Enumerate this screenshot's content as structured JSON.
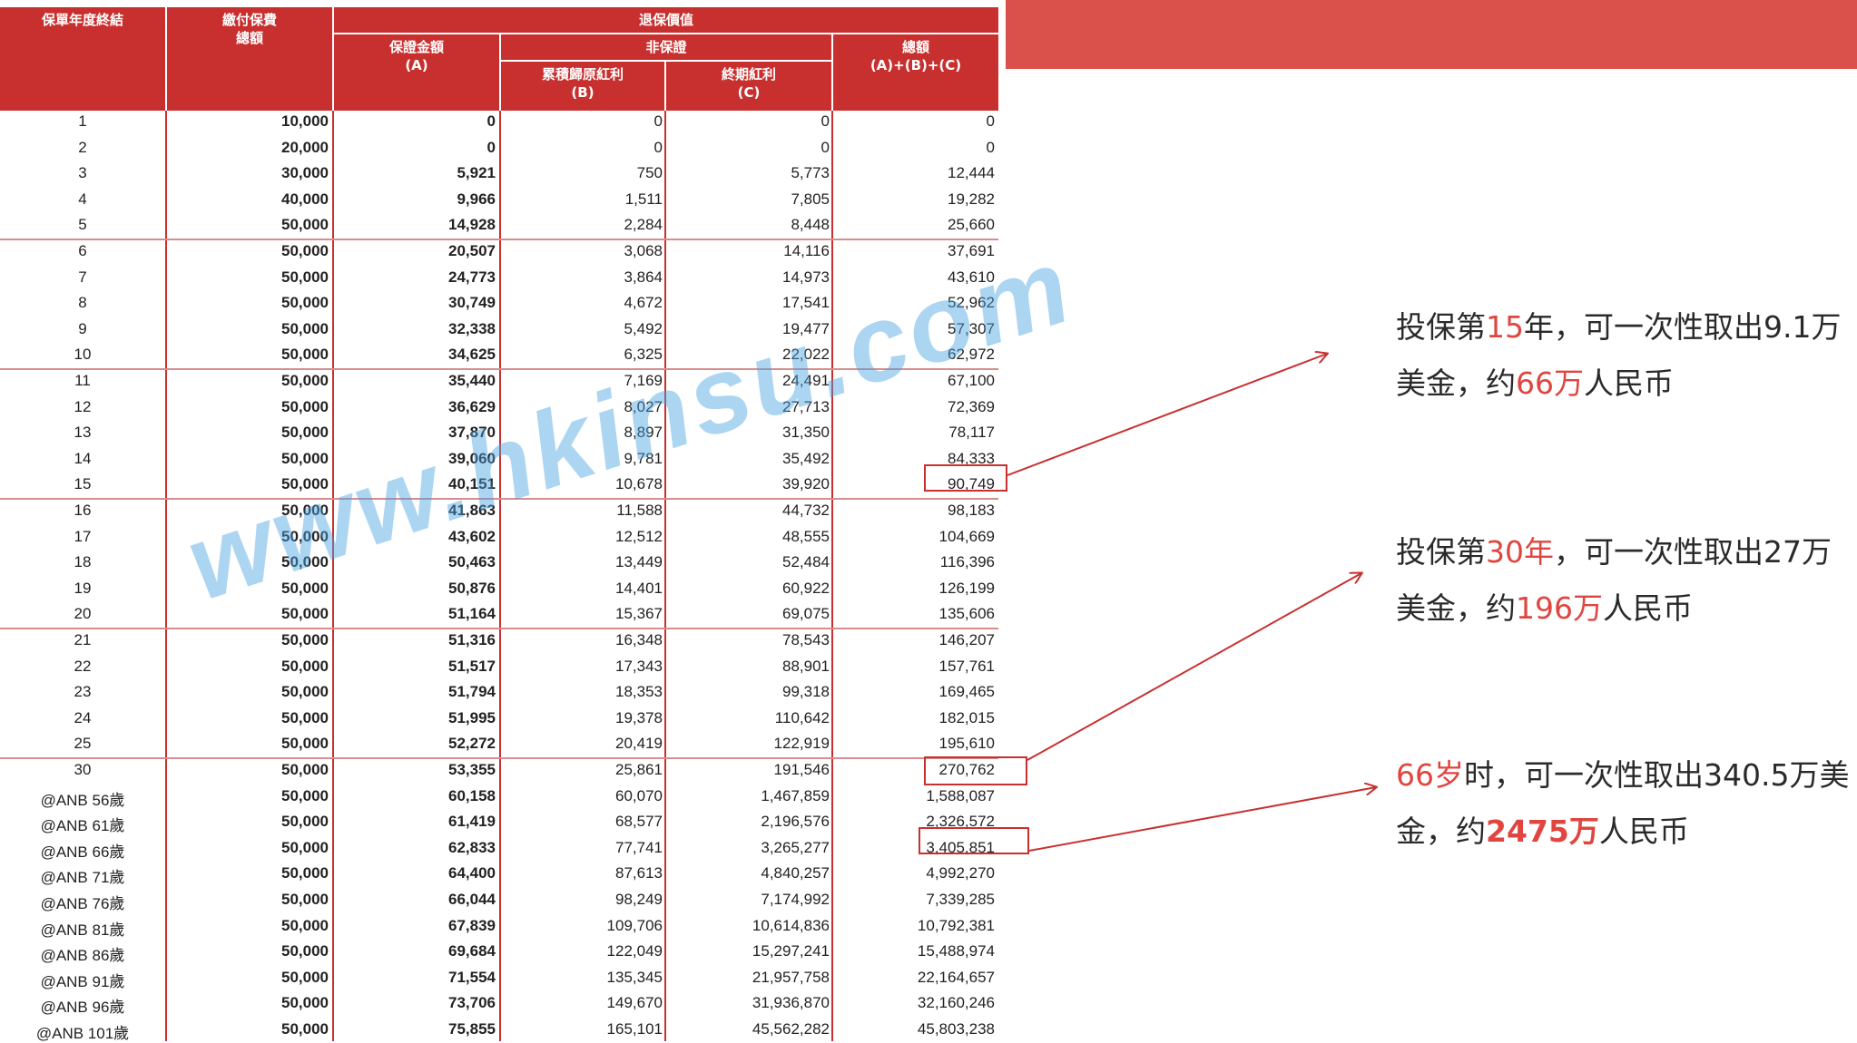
{
  "table": {
    "headers": {
      "year_end": "保單年度終結",
      "premium": [
        "繳付保費",
        "總額"
      ],
      "surrender_value": "退保價值",
      "guaranteed": [
        "保證金額",
        "(A)"
      ],
      "non_guaranteed": "非保證",
      "reversionary": [
        "累積歸原紅利",
        "(B)"
      ],
      "terminal": [
        "終期紅利",
        "(C)"
      ],
      "total": [
        "總額",
        "(A)+(B)+(C)"
      ]
    },
    "rows": [
      [
        "1",
        "10,000",
        "0",
        "0",
        "0",
        "0"
      ],
      [
        "2",
        "20,000",
        "0",
        "0",
        "0",
        "0"
      ],
      [
        "3",
        "30,000",
        "5,921",
        "750",
        "5,773",
        "12,444"
      ],
      [
        "4",
        "40,000",
        "9,966",
        "1,511",
        "7,805",
        "19,282"
      ],
      [
        "5",
        "50,000",
        "14,928",
        "2,284",
        "8,448",
        "25,660"
      ],
      [
        "6",
        "50,000",
        "20,507",
        "3,068",
        "14,116",
        "37,691"
      ],
      [
        "7",
        "50,000",
        "24,773",
        "3,864",
        "14,973",
        "43,610"
      ],
      [
        "8",
        "50,000",
        "30,749",
        "4,672",
        "17,541",
        "52,962"
      ],
      [
        "9",
        "50,000",
        "32,338",
        "5,492",
        "19,477",
        "57,307"
      ],
      [
        "10",
        "50,000",
        "34,625",
        "6,325",
        "22,022",
        "62,972"
      ],
      [
        "11",
        "50,000",
        "35,440",
        "7,169",
        "24,491",
        "67,100"
      ],
      [
        "12",
        "50,000",
        "36,629",
        "8,027",
        "27,713",
        "72,369"
      ],
      [
        "13",
        "50,000",
        "37,870",
        "8,897",
        "31,350",
        "78,117"
      ],
      [
        "14",
        "50,000",
        "39,060",
        "9,781",
        "35,492",
        "84,333"
      ],
      [
        "15",
        "50,000",
        "40,151",
        "10,678",
        "39,920",
        "90,749"
      ],
      [
        "16",
        "50,000",
        "41,863",
        "11,588",
        "44,732",
        "98,183"
      ],
      [
        "17",
        "50,000",
        "43,602",
        "12,512",
        "48,555",
        "104,669"
      ],
      [
        "18",
        "50,000",
        "50,463",
        "13,449",
        "52,484",
        "116,396"
      ],
      [
        "19",
        "50,000",
        "50,876",
        "14,401",
        "60,922",
        "126,199"
      ],
      [
        "20",
        "50,000",
        "51,164",
        "15,367",
        "69,075",
        "135,606"
      ],
      [
        "21",
        "50,000",
        "51,316",
        "16,348",
        "78,543",
        "146,207"
      ],
      [
        "22",
        "50,000",
        "51,517",
        "17,343",
        "88,901",
        "157,761"
      ],
      [
        "23",
        "50,000",
        "51,794",
        "18,353",
        "99,318",
        "169,465"
      ],
      [
        "24",
        "50,000",
        "51,995",
        "19,378",
        "110,642",
        "182,015"
      ],
      [
        "25",
        "50,000",
        "52,272",
        "20,419",
        "122,919",
        "195,610"
      ],
      [
        "30",
        "50,000",
        "53,355",
        "25,861",
        "191,546",
        "270,762"
      ],
      [
        "@ANB 56歲",
        "50,000",
        "60,158",
        "60,070",
        "1,467,859",
        "1,588,087"
      ],
      [
        "@ANB 61歲",
        "50,000",
        "61,419",
        "68,577",
        "2,196,576",
        "2,326,572"
      ],
      [
        "@ANB 66歲",
        "50,000",
        "62,833",
        "77,741",
        "3,265,277",
        "3,405,851"
      ],
      [
        "@ANB 71歲",
        "50,000",
        "64,400",
        "87,613",
        "4,840,257",
        "4,992,270"
      ],
      [
        "@ANB 76歲",
        "50,000",
        "66,044",
        "98,249",
        "7,174,992",
        "7,339,285"
      ],
      [
        "@ANB 81歲",
        "50,000",
        "67,839",
        "109,706",
        "10,614,836",
        "10,792,381"
      ],
      [
        "@ANB 86歲",
        "50,000",
        "69,684",
        "122,049",
        "15,297,241",
        "15,488,974"
      ],
      [
        "@ANB 91歲",
        "50,000",
        "71,554",
        "135,345",
        "21,957,758",
        "22,164,657"
      ],
      [
        "@ANB 96歲",
        "50,000",
        "73,706",
        "149,670",
        "31,936,870",
        "32,160,246"
      ],
      [
        "@ANB 101歲",
        "50,000",
        "75,855",
        "165,101",
        "45,562,282",
        "45,803,238"
      ]
    ]
  },
  "watermark": "www.hkinsu.com",
  "notes": [
    {
      "parts": [
        [
          "投保第",
          ""
        ],
        [
          "15",
          "red"
        ],
        [
          "年，可一次性取出9.1万美金，约",
          ""
        ],
        [
          "66万",
          "red"
        ],
        [
          "人民币",
          ""
        ]
      ]
    },
    {
      "parts": [
        [
          "投保第",
          ""
        ],
        [
          "30年",
          "red"
        ],
        [
          "，可一次性取出27万美金，约",
          ""
        ],
        [
          "196万",
          "red"
        ],
        [
          "人民币",
          ""
        ]
      ]
    },
    {
      "parts": [
        [
          "66岁",
          "red"
        ],
        [
          "时，可一次性取出340.5万美金，约",
          ""
        ],
        [
          "2475万",
          "redb"
        ],
        [
          "人民币",
          ""
        ]
      ]
    }
  ],
  "colors": {
    "header_red": "#c8302f",
    "banner_red": "#d9514a",
    "accent_red": "#e0453f",
    "watermark_blue": "#4aa3e3"
  }
}
